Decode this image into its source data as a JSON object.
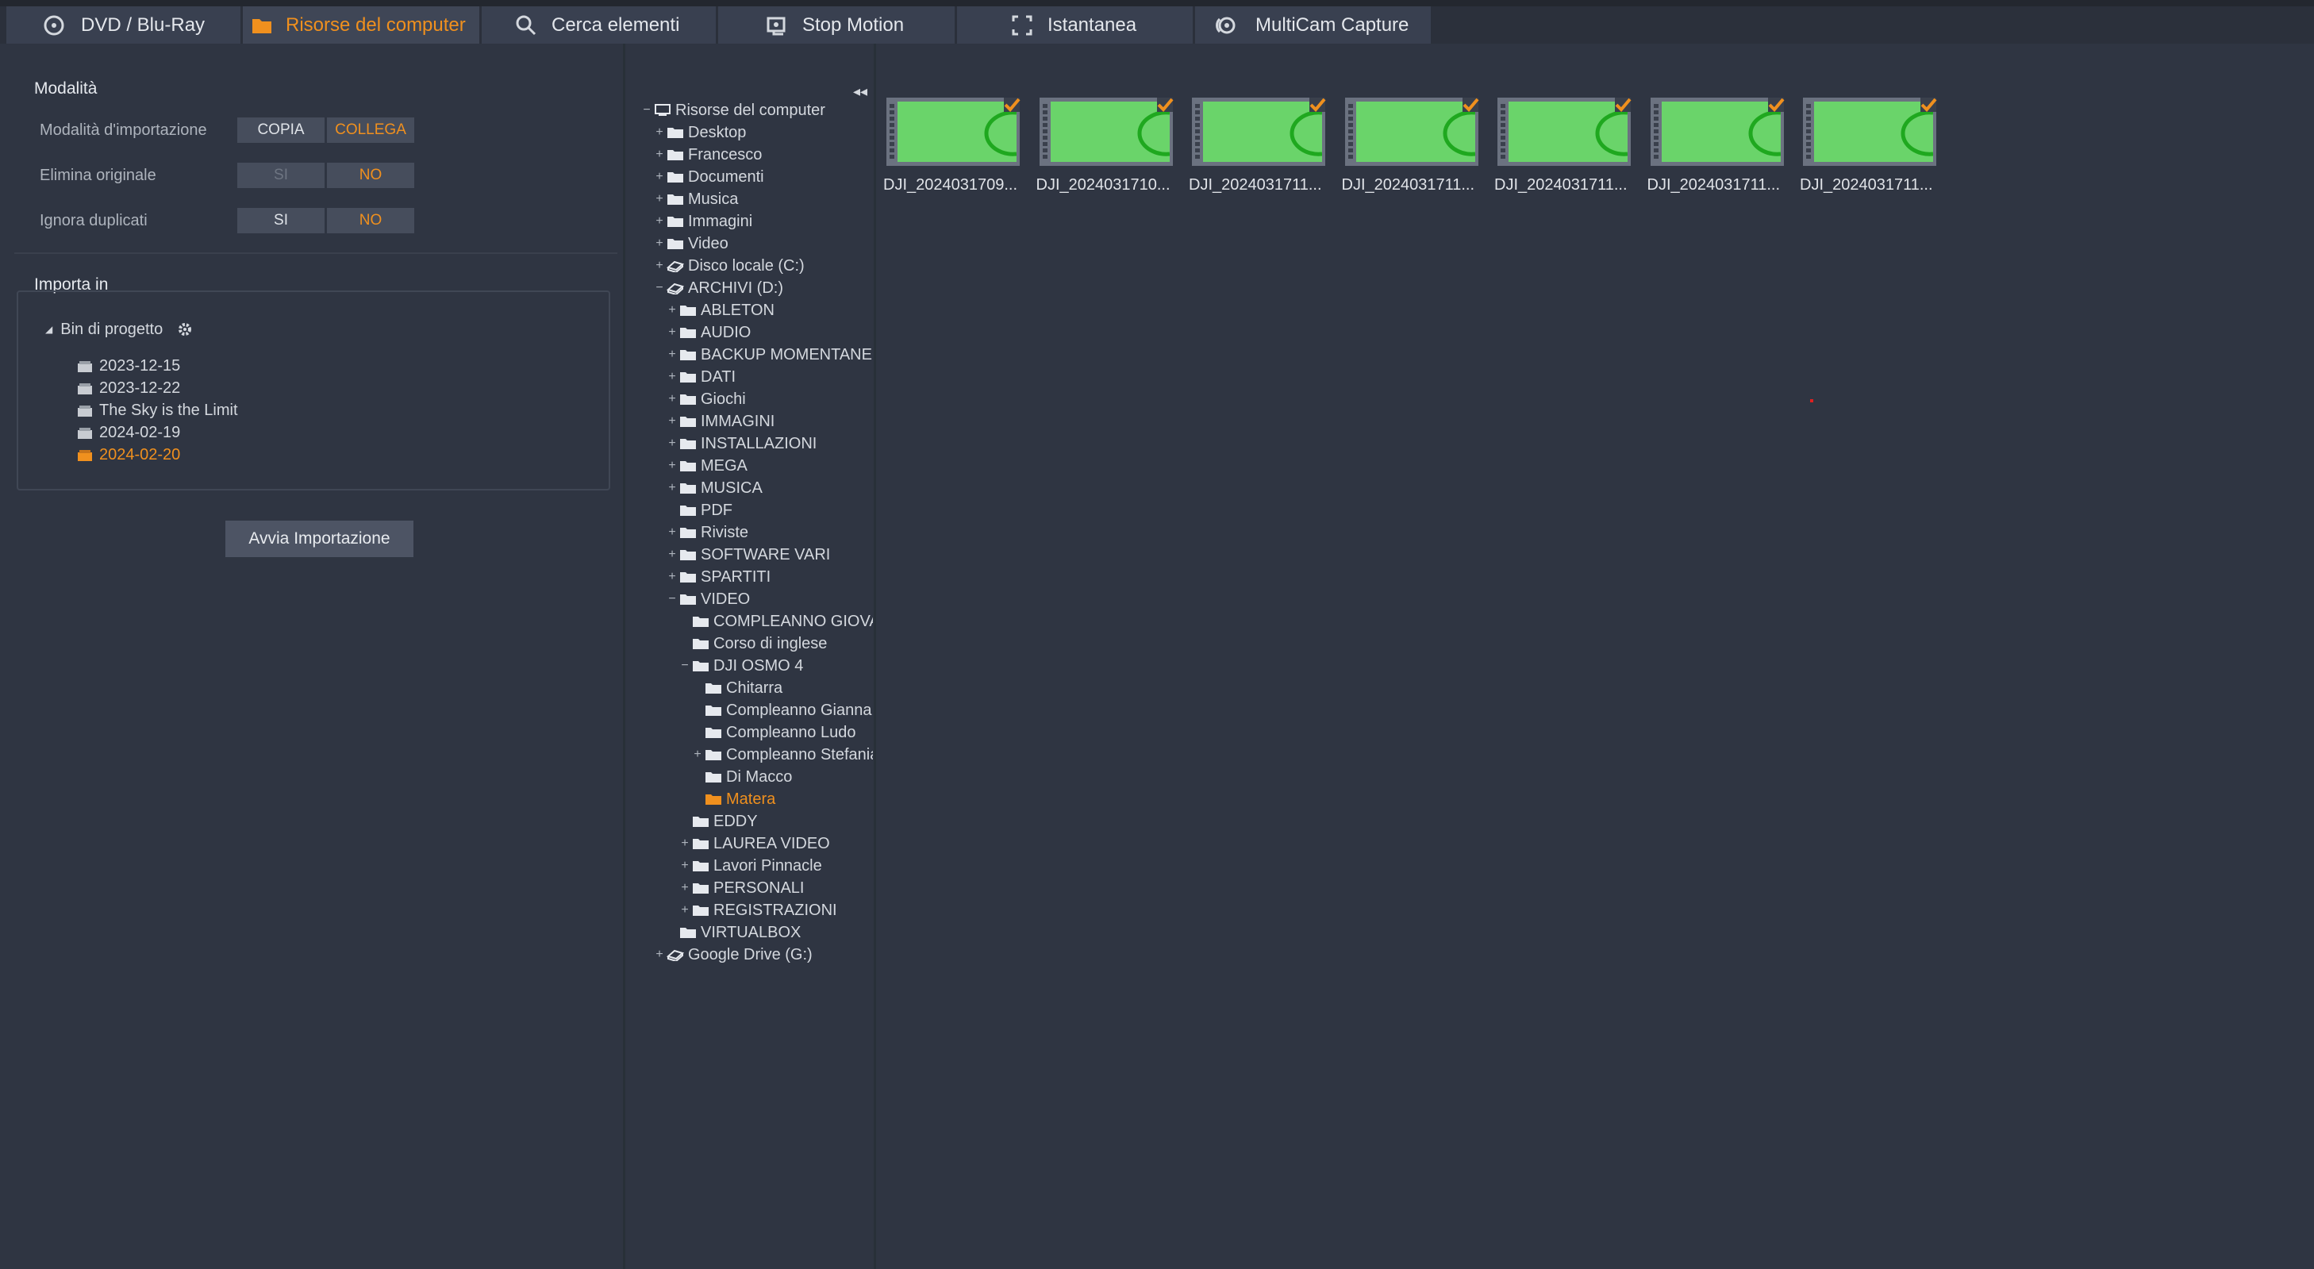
{
  "tabs": [
    {
      "label": "DVD / Blu-Ray",
      "icon": "disc-icon",
      "active": false
    },
    {
      "label": "Risorse del computer",
      "icon": "folder-icon",
      "active": true
    },
    {
      "label": "Cerca elementi",
      "icon": "search-icon",
      "active": false
    },
    {
      "label": "Stop Motion",
      "icon": "stop-motion-icon",
      "active": false
    },
    {
      "label": "Istantanea",
      "icon": "snapshot-icon",
      "active": false
    },
    {
      "label": "MultiCam Capture",
      "icon": "multicam-icon",
      "active": false
    }
  ],
  "mode": {
    "title": "Modalità",
    "import_mode": {
      "label": "Modalità d'importazione",
      "opt1": "COPIA",
      "opt2": "COLLEGA",
      "selected": "COLLEGA"
    },
    "delete_original": {
      "label": "Elimina originale",
      "opt1": "SI",
      "opt2": "NO",
      "selected": "NO"
    },
    "ignore_duplicates": {
      "label": "Ignora duplicati",
      "opt1": "SI",
      "opt2": "NO",
      "selected": "NO"
    }
  },
  "import_to": {
    "title": "Importa in",
    "root": "Bin di progetto",
    "bins": [
      "2023-12-15",
      "2023-12-22",
      "The Sky is the Limit",
      "2024-02-19",
      "2024-02-20"
    ],
    "selected": "2024-02-20"
  },
  "start_button": "Avvia Importazione",
  "tree": [
    {
      "label": "Risorse del computer",
      "level": 0,
      "toggle": "−",
      "icon": "computer-icon"
    },
    {
      "label": "Desktop",
      "level": 1,
      "toggle": "+",
      "icon": "folder-icon"
    },
    {
      "label": "Francesco",
      "level": 1,
      "toggle": "+",
      "icon": "folder-icon"
    },
    {
      "label": "Documenti",
      "level": 1,
      "toggle": "+",
      "icon": "folder-icon"
    },
    {
      "label": "Musica",
      "level": 1,
      "toggle": "+",
      "icon": "folder-icon"
    },
    {
      "label": "Immagini",
      "level": 1,
      "toggle": "+",
      "icon": "folder-icon"
    },
    {
      "label": "Video",
      "level": 1,
      "toggle": "+",
      "icon": "folder-icon"
    },
    {
      "label": "Disco locale (C:)",
      "level": 1,
      "toggle": "+",
      "icon": "drive-icon"
    },
    {
      "label": "ARCHIVI (D:)",
      "level": 1,
      "toggle": "−",
      "icon": "drive-icon"
    },
    {
      "label": "ABLETON",
      "level": 2,
      "toggle": "+",
      "icon": "folder-icon"
    },
    {
      "label": "AUDIO",
      "level": 2,
      "toggle": "+",
      "icon": "folder-icon"
    },
    {
      "label": "BACKUP MOMENTANEO",
      "level": 2,
      "toggle": "+",
      "icon": "folder-icon"
    },
    {
      "label": "DATI",
      "level": 2,
      "toggle": "+",
      "icon": "folder-icon"
    },
    {
      "label": "Giochi",
      "level": 2,
      "toggle": "+",
      "icon": "folder-icon"
    },
    {
      "label": "IMMAGINI",
      "level": 2,
      "toggle": "+",
      "icon": "folder-icon"
    },
    {
      "label": "INSTALLAZIONI",
      "level": 2,
      "toggle": "+",
      "icon": "folder-icon"
    },
    {
      "label": "MEGA",
      "level": 2,
      "toggle": "+",
      "icon": "folder-icon"
    },
    {
      "label": "MUSICA",
      "level": 2,
      "toggle": "+",
      "icon": "folder-icon"
    },
    {
      "label": "PDF",
      "level": 2,
      "toggle": "",
      "icon": "folder-icon"
    },
    {
      "label": "Riviste",
      "level": 2,
      "toggle": "+",
      "icon": "folder-icon"
    },
    {
      "label": "SOFTWARE VARI",
      "level": 2,
      "toggle": "+",
      "icon": "folder-icon"
    },
    {
      "label": "SPARTITI",
      "level": 2,
      "toggle": "+",
      "icon": "folder-icon"
    },
    {
      "label": "VIDEO",
      "level": 2,
      "toggle": "−",
      "icon": "folder-icon"
    },
    {
      "label": "COMPLEANNO GIOVANNI",
      "level": 3,
      "toggle": "",
      "icon": "folder-icon"
    },
    {
      "label": "Corso di inglese",
      "level": 3,
      "toggle": "",
      "icon": "folder-icon"
    },
    {
      "label": "DJI OSMO 4",
      "level": 3,
      "toggle": "−",
      "icon": "folder-icon"
    },
    {
      "label": "Chitarra",
      "level": 4,
      "toggle": "",
      "icon": "folder-icon"
    },
    {
      "label": "Compleanno Gianna",
      "level": 4,
      "toggle": "",
      "icon": "folder-icon"
    },
    {
      "label": "Compleanno Ludo",
      "level": 4,
      "toggle": "",
      "icon": "folder-icon"
    },
    {
      "label": "Compleanno Stefania",
      "level": 4,
      "toggle": "+",
      "icon": "folder-icon"
    },
    {
      "label": "Di Macco",
      "level": 4,
      "toggle": "",
      "icon": "folder-icon"
    },
    {
      "label": "Matera",
      "level": 4,
      "toggle": "",
      "icon": "folder-icon",
      "selected": true
    },
    {
      "label": "EDDY",
      "level": 3,
      "toggle": "",
      "icon": "folder-icon"
    },
    {
      "label": "LAUREA VIDEO",
      "level": 3,
      "toggle": "+",
      "icon": "folder-icon"
    },
    {
      "label": "Lavori Pinnacle",
      "level": 3,
      "toggle": "+",
      "icon": "folder-icon"
    },
    {
      "label": "PERSONALI",
      "level": 3,
      "toggle": "+",
      "icon": "folder-icon"
    },
    {
      "label": "REGISTRAZIONI",
      "level": 3,
      "toggle": "+",
      "icon": "folder-icon"
    },
    {
      "label": "VIRTUALBOX",
      "level": 2,
      "toggle": "",
      "icon": "folder-icon"
    },
    {
      "label": "Google Drive (G:)",
      "level": 1,
      "toggle": "+",
      "icon": "drive-icon"
    }
  ],
  "collapse_glyph": "◂◂",
  "files": [
    {
      "name": "DJI_2024031709..."
    },
    {
      "name": "DJI_2024031710..."
    },
    {
      "name": "DJI_2024031711..."
    },
    {
      "name": "DJI_2024031711..."
    },
    {
      "name": "DJI_2024031711..."
    },
    {
      "name": "DJI_2024031711..."
    },
    {
      "name": "DJI_2024031711..."
    }
  ],
  "colors": {
    "accent": "#f0901e",
    "background": "#2f3542",
    "thumb_green": "#6ad46a"
  }
}
